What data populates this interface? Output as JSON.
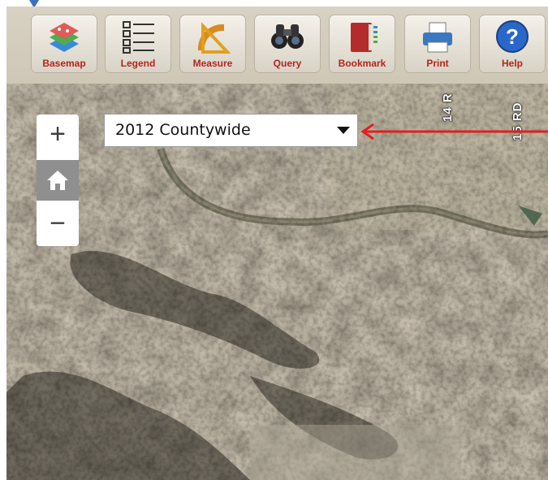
{
  "toolbar": {
    "tools": [
      {
        "label": "Basemap",
        "icon": "basemap-icon"
      },
      {
        "label": "Legend",
        "icon": "legend-icon"
      },
      {
        "label": "Measure",
        "icon": "measure-icon"
      },
      {
        "label": "Query",
        "icon": "binoculars-icon"
      },
      {
        "label": "Bookmark",
        "icon": "bookmark-icon"
      },
      {
        "label": "Print",
        "icon": "printer-icon"
      },
      {
        "label": "Help",
        "icon": "help-icon"
      }
    ]
  },
  "map": {
    "basemap_selector": {
      "value": "2012 Countywide"
    },
    "zoom": {
      "in_symbol": "+",
      "out_symbol": "−",
      "home_icon": "home-icon"
    },
    "road_labels": [
      "14 R",
      "15 RD"
    ]
  },
  "colors": {
    "tool_label": "#b3241e",
    "annotation_arrow": "#e02020",
    "marker": "#3b73b9"
  }
}
